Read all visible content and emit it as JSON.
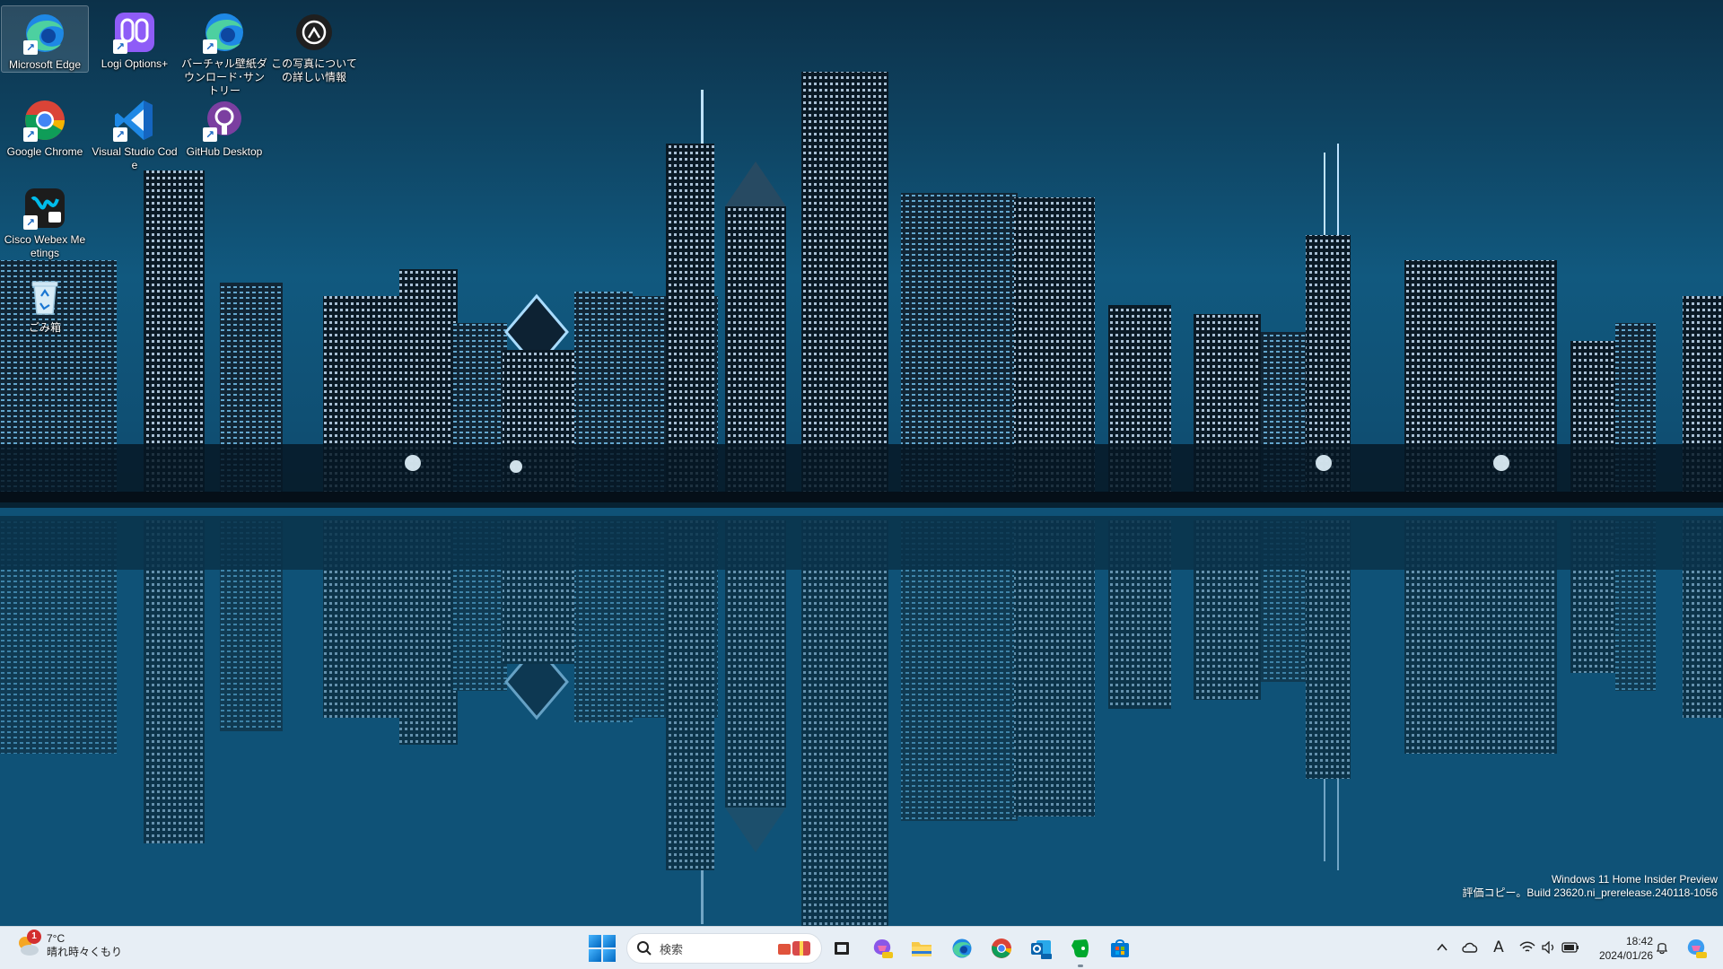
{
  "desktop": {
    "icons": [
      {
        "label": "Microsoft Edge",
        "icon": "edge-icon"
      },
      {
        "label": "Logi Options+",
        "icon": "logi-options-icon"
      },
      {
        "label": "バーチャル壁紙ダウンロード･サントリー",
        "icon": "edge-icon"
      },
      {
        "label": "この写真についての詳しい情報",
        "icon": "camera-info-icon"
      },
      {
        "label": "Google Chrome",
        "icon": "chrome-icon"
      },
      {
        "label": "Visual Studio Code",
        "icon": "vscode-icon"
      },
      {
        "label": "GitHub Desktop",
        "icon": "github-desktop-icon"
      },
      {
        "label": "Cisco Webex Meetings",
        "icon": "webex-icon"
      },
      {
        "label": "ごみ箱",
        "icon": "recycle-bin-icon"
      }
    ]
  },
  "watermark": {
    "line1": "Windows 11 Home Insider Preview",
    "line2": "評価コピー。Build 23620.ni_prerelease.240118-1056"
  },
  "taskbar": {
    "weather": {
      "temp": "7°C",
      "condition": "晴れ時々くもり",
      "badge": "1"
    },
    "search_placeholder": "検索",
    "apps": [
      {
        "name": "task-view",
        "icon": "task-view-icon"
      },
      {
        "name": "copilot-pre",
        "icon": "copilot-icon"
      },
      {
        "name": "file-explorer",
        "icon": "folder-icon"
      },
      {
        "name": "edge",
        "icon": "edge-icon"
      },
      {
        "name": "chrome",
        "icon": "chrome-icon"
      },
      {
        "name": "outlook-new",
        "icon": "outlook-icon"
      },
      {
        "name": "evernote",
        "icon": "evernote-icon"
      },
      {
        "name": "microsoft-store",
        "icon": "store-icon"
      }
    ],
    "tray": {
      "ime": "A",
      "time": "18:42",
      "date": "2024/01/26"
    }
  },
  "colors": {
    "taskbar_bg": "#e7eef5",
    "accent": "#0067c0",
    "wallpaper_sky": "#0d3652"
  }
}
